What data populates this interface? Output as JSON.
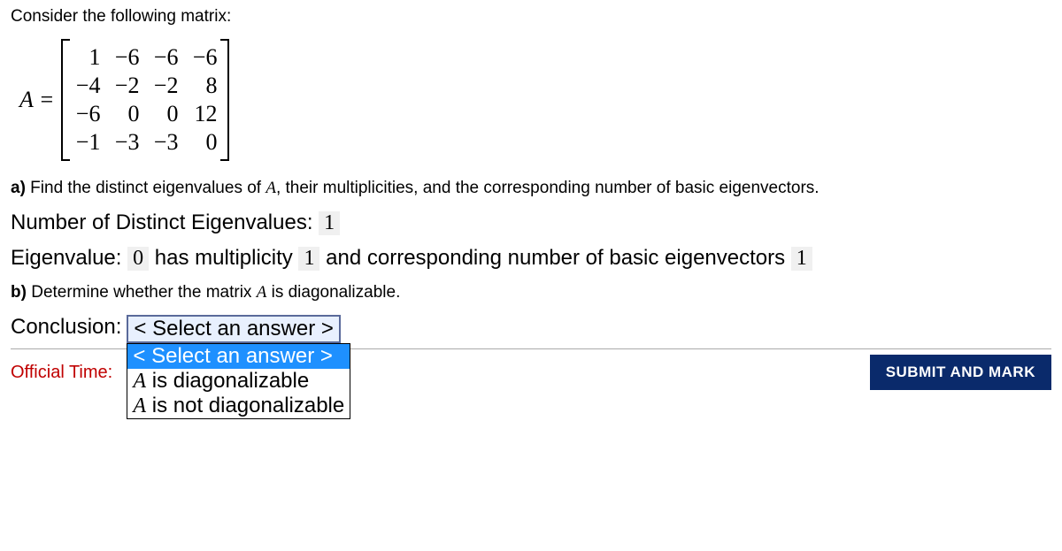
{
  "intro": "Consider the following matrix:",
  "matrix_label": "A =",
  "matrix": {
    "rows": [
      [
        "1",
        "−6",
        "−6",
        "−6"
      ],
      [
        "−4",
        "−2",
        "−2",
        "8"
      ],
      [
        "−6",
        "0",
        "0",
        "12"
      ],
      [
        "−1",
        "−3",
        "−3",
        "0"
      ]
    ]
  },
  "part_a": {
    "label": "a)",
    "text": " Find the distinct eigenvalues of ",
    "matrix_var": "A",
    "text2": ", their multiplicities, and the corresponding number of basic eigenvectors."
  },
  "answers": {
    "num_distinct_label": "Number of Distinct Eigenvalues: ",
    "num_distinct_value": "1",
    "eig_label": "Eigenvalue: ",
    "eig_value": "0",
    "mult_label": " has multiplicity ",
    "mult_value": "1",
    "basic_label": " and corresponding number of basic eigenvectors ",
    "basic_value": "1"
  },
  "part_b": {
    "label": "b)",
    "text": " Determine whether the matrix ",
    "matrix_var": "A",
    "text2": " is diagonalizable."
  },
  "conclusion": {
    "label": "Conclusion:",
    "selected": "< Select an answer >",
    "options": [
      "< Select an answer >",
      "A is diagonalizable",
      "A is not diagonalizable"
    ]
  },
  "footer": {
    "official_time": "Official Time:",
    "submit": "SUBMIT AND MARK"
  }
}
